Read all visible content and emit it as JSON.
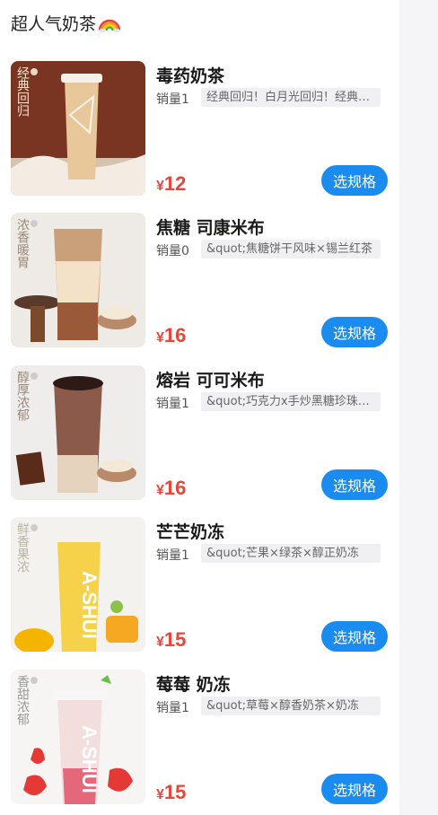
{
  "section": {
    "title": "超人气奶茶",
    "icon": "rainbow-icon"
  },
  "products": [
    {
      "name": "毒药奶茶",
      "sales": "销量1",
      "desc": "经典回归！白月光回归！经典重现",
      "currency": "¥",
      "price": "12",
      "button": "选规格",
      "tag": "经典回归"
    },
    {
      "name": "焦糖 司康米布",
      "sales": "销量0",
      "desc": "&quot;焦糖饼干风味×锡兰红茶",
      "currency": "¥",
      "price": "16",
      "button": "选规格",
      "tag": "浓香暖胃"
    },
    {
      "name": "熔岩 可可米布",
      "sales": "销量1",
      "desc": "&quot;巧克力x手炒黑糖珍珠奶茶",
      "currency": "¥",
      "price": "16",
      "button": "选规格",
      "tag": "醇厚浓郁"
    },
    {
      "name": "芒芒奶冻",
      "sales": "销量1",
      "desc": "&quot;芒果×绿茶×醇正奶冻",
      "currency": "¥",
      "price": "15",
      "button": "选规格",
      "tag": "鲜香果浓"
    },
    {
      "name": "莓莓 奶冻",
      "sales": "销量1",
      "desc": "&quot;草莓×醇香奶茶×奶冻",
      "currency": "¥",
      "price": "15",
      "button": "选规格",
      "tag": "香甜浓郁"
    }
  ],
  "colors": {
    "price": "#e8463a",
    "button": "#1a8cf0",
    "desc_bg": "#f0f0f2"
  }
}
